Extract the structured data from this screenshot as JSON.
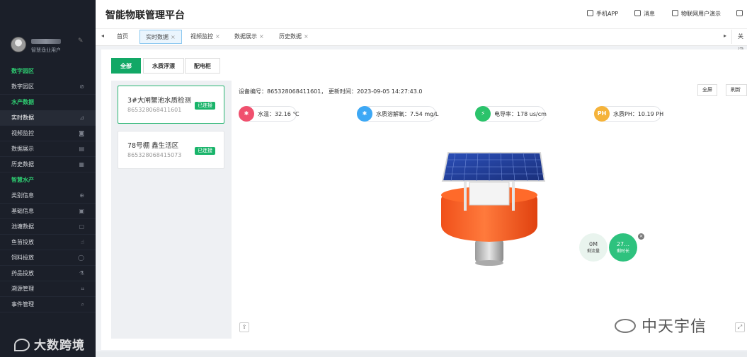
{
  "sidebar": {
    "user_role": "智慧渔业用户",
    "sections": [
      {
        "label": "数字园区",
        "items": [
          {
            "label": "数字园区",
            "icon": "compass-icon"
          }
        ]
      },
      {
        "label": "水产数据",
        "items": [
          {
            "label": "实时数据",
            "icon": "chart-icon",
            "active": true
          },
          {
            "label": "视频监控",
            "icon": "camera-icon"
          },
          {
            "label": "数据展示",
            "icon": "table-icon"
          },
          {
            "label": "历史数据",
            "icon": "history-icon"
          }
        ]
      },
      {
        "label": "智慧水产",
        "items": [
          {
            "label": "类别信息",
            "icon": "circle-plus-icon"
          },
          {
            "label": "基础信息",
            "icon": "doc-icon"
          },
          {
            "label": "池塘数据",
            "icon": "grid-icon"
          },
          {
            "label": "鱼苗投放",
            "icon": "thumb-icon"
          },
          {
            "label": "饲料投放",
            "icon": "circle-icon"
          },
          {
            "label": "药品投放",
            "icon": "flask-icon"
          },
          {
            "label": "溯源管理",
            "icon": "scan-icon"
          },
          {
            "label": "事件管理",
            "icon": "search-icon"
          }
        ]
      }
    ],
    "watermark": "大数跨境"
  },
  "header": {
    "title": "智能物联管理平台",
    "links": [
      "手机APP",
      "消息",
      "物联网用户演示"
    ]
  },
  "tabs": {
    "items": [
      {
        "label": "首页",
        "closable": false
      },
      {
        "label": "实时数据",
        "closable": true,
        "active": true
      },
      {
        "label": "视频监控",
        "closable": true
      },
      {
        "label": "数据展示",
        "closable": true
      },
      {
        "label": "历史数据",
        "closable": true
      }
    ],
    "close_all": "关闭"
  },
  "filters": [
    "全部",
    "水质浮漂",
    "配电柜"
  ],
  "devices": [
    {
      "name": "3#大闸蟹池水质检测",
      "id": "865328068411601",
      "status": "已连接",
      "active": true
    },
    {
      "name": "78号棚 鑫生活区",
      "id": "865328068415073",
      "status": "已连接",
      "active": false
    }
  ],
  "detail": {
    "info": "设备编号：865328068411601，  更新时间：2023-09-05 14:27:43.0",
    "fullscreen_label": "全屏",
    "refresh_label": "刷新",
    "metrics": [
      {
        "label": "水温：32.16 ℃",
        "icon": "thermometer-icon",
        "color": "#f0506e"
      },
      {
        "label": "水质溶解氧：7.54 mg/L",
        "icon": "oxygen-icon",
        "color": "#3da8f5"
      },
      {
        "label": "电导率：178 us/cm",
        "icon": "lightning-icon",
        "color": "#2bc36b"
      },
      {
        "label": "水质PH：10.19 PH",
        "icon": "ph-icon",
        "icon_text": "PH",
        "color": "#f5b33a"
      }
    ]
  },
  "floater": {
    "flow_value": "0M",
    "flow_label": "剩流量",
    "time_value": "27…",
    "time_label": "剩时长"
  },
  "watermark_right": "中天宇信"
}
